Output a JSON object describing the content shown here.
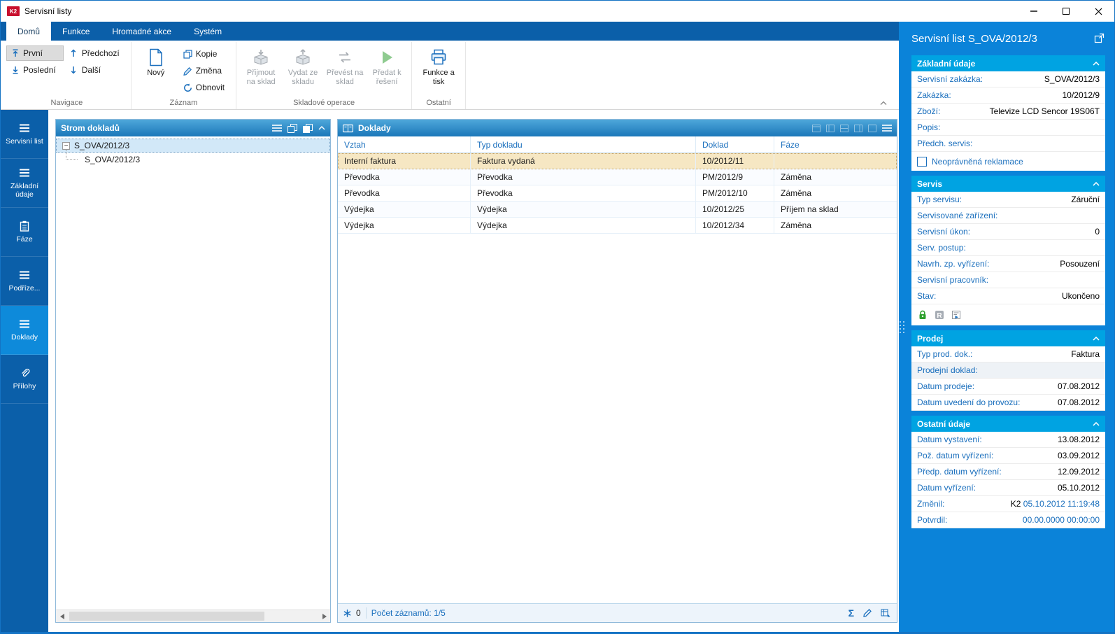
{
  "window": {
    "title": "Servisní listy",
    "logo": "K2"
  },
  "ribbon": {
    "tabs": [
      "Domů",
      "Funkce",
      "Hromadné akce",
      "Systém"
    ],
    "active_tab": "Domů",
    "buttons": {
      "prvni": "První",
      "posledni": "Poslední",
      "predchozi": "Předchozí",
      "dalsi": "Další",
      "novy": "Nový",
      "kopie": "Kopie",
      "zmena": "Změna",
      "obnovit": "Obnovit",
      "prijmout": "Přijmout na sklad",
      "vydat": "Vydat ze skladu",
      "prevest": "Převést na sklad",
      "predat": "Předat k řešení",
      "funkce_tisk": "Funkce a tisk"
    },
    "group_labels": {
      "navigace": "Navigace",
      "zaznam": "Záznam",
      "sklad": "Skladové operace",
      "ostatni": "Ostatní"
    }
  },
  "sidebar": {
    "items": [
      {
        "label": "Servisní list",
        "icon": "list-icon",
        "active": false
      },
      {
        "label": "Základní údaje",
        "icon": "list-icon",
        "active": false
      },
      {
        "label": "Fáze",
        "icon": "clipboard-icon",
        "active": false
      },
      {
        "label": "Podříze...",
        "icon": "list-icon",
        "active": false
      },
      {
        "label": "Doklady",
        "icon": "list-icon",
        "active": true
      },
      {
        "label": "Přílohy",
        "icon": "paperclip-icon",
        "active": false
      }
    ]
  },
  "tree_panel": {
    "title": "Strom dokladů",
    "nodes": [
      {
        "label": "S_OVA/2012/3",
        "level": 0,
        "expanded": true,
        "selected": true
      },
      {
        "label": "S_OVA/2012/3",
        "level": 1,
        "expanded": false,
        "selected": false
      }
    ]
  },
  "documents_panel": {
    "title": "Doklady",
    "columns": [
      "Vztah",
      "Typ dokladu",
      "Doklad",
      "Fáze"
    ],
    "rows": [
      {
        "cells": [
          "Interní faktura",
          "Faktura vydaná",
          "10/2012/11",
          ""
        ],
        "selected": true
      },
      {
        "cells": [
          "Převodka",
          "Převodka",
          "PM/2012/9",
          "Záměna"
        ],
        "selected": false
      },
      {
        "cells": [
          "Převodka",
          "Převodka",
          "PM/2012/10",
          "Záměna"
        ],
        "selected": false
      },
      {
        "cells": [
          "Výdejka",
          "Výdejka",
          "10/2012/25",
          "Příjem na sklad"
        ],
        "selected": false
      },
      {
        "cells": [
          "Výdejka",
          "Výdejka",
          "10/2012/34",
          "Záměna"
        ],
        "selected": false
      }
    ],
    "status": {
      "counter": "0",
      "records": "Počet záznamů: 1/5"
    }
  },
  "detail_panel": {
    "title": "Servisní list S_OVA/2012/3",
    "sections": [
      {
        "title": "Základní údaje",
        "fields": [
          {
            "label": "Servisní zakázka:",
            "value": "S_OVA/2012/3"
          },
          {
            "label": "Zakázka:",
            "value": "10/2012/9"
          },
          {
            "label": "Zboží:",
            "value": "Televize LCD Sencor 19S06T"
          },
          {
            "label": "Popis:",
            "value": ""
          },
          {
            "label": "Předch. servis:",
            "value": ""
          }
        ],
        "checkbox": {
          "label": "Neoprávněná reklamace",
          "checked": false
        }
      },
      {
        "title": "Servis",
        "fields": [
          {
            "label": "Typ servisu:",
            "value": "Záruční"
          },
          {
            "label": "Servisované zařízení:",
            "value": ""
          },
          {
            "label": "Servisní úkon:",
            "value": "0"
          },
          {
            "label": "Serv. postup:",
            "value": ""
          },
          {
            "label": "Navrh. zp. vyřízení:",
            "value": "Posouzení"
          },
          {
            "label": "Servisní pracovník:",
            "value": ""
          },
          {
            "label": "Stav:",
            "value": "Ukončeno"
          }
        ],
        "status_icons": [
          "lock-icon",
          "r-badge-icon",
          "protocol-icon"
        ]
      },
      {
        "title": "Prodej",
        "fields": [
          {
            "label": "Typ prod. dok.:",
            "value": "Faktura"
          },
          {
            "label": "Prodejní doklad:",
            "value": "",
            "shaded": true
          },
          {
            "label": "Datum prodeje:",
            "value": "07.08.2012"
          },
          {
            "label": "Datum uvedení do provozu:",
            "value": "07.08.2012"
          }
        ]
      },
      {
        "title": "Ostatní údaje",
        "fields": [
          {
            "label": "Datum vystavení:",
            "value": "13.08.2012"
          },
          {
            "label": "Pož. datum vyřízení:",
            "value": "03.09.2012"
          },
          {
            "label": "Předp. datum vyřízení:",
            "value": "12.09.2012"
          },
          {
            "label": "Datum vyřízení:",
            "value": "05.10.2012"
          },
          {
            "label": "Změnil:",
            "prefix": "K2",
            "value": "05.10.2012 11:19:48",
            "blue": true
          },
          {
            "label": "Potvrdil:",
            "value": "00.00.0000 00:00:00",
            "blue": true
          }
        ]
      }
    ]
  },
  "colors": {
    "accent_dark": "#0b5fa9",
    "accent_bright": "#0b83d9",
    "section_header": "#00a3e2",
    "selected_row": "#f6e7c3",
    "label_blue": "#1a6fbd"
  }
}
